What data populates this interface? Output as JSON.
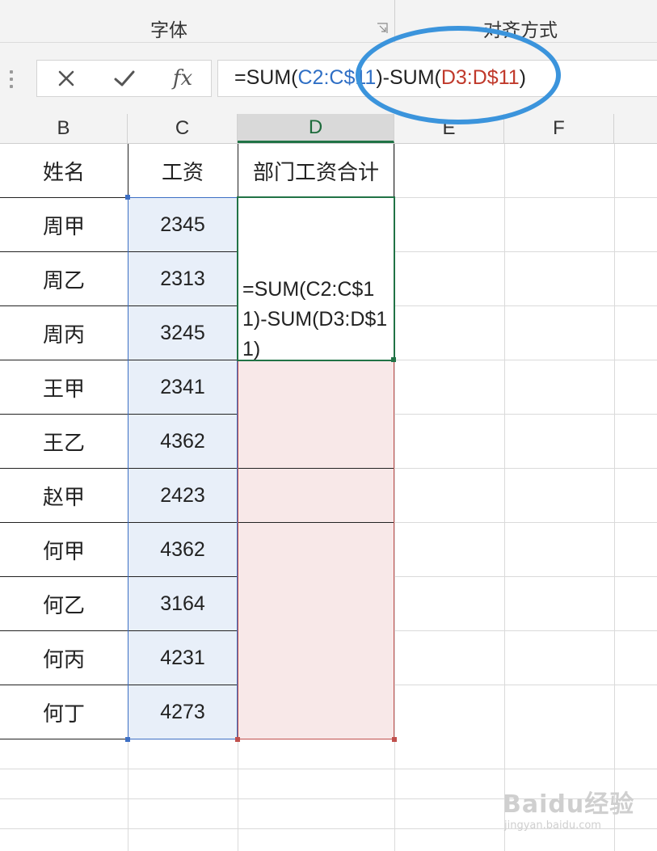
{
  "ribbon": {
    "groups": [
      {
        "label": "字体"
      },
      {
        "label": "对齐方式"
      }
    ]
  },
  "formula_bar": {
    "cancel_icon": "close-icon",
    "enter_icon": "check-icon",
    "fx_label": "fx",
    "formula_parts": {
      "prefix": "=SUM(",
      "ref1": "C2:C$11",
      "middle": ")-SUM(",
      "ref2": "D3:D$11",
      "suffix": ")"
    }
  },
  "columns": [
    "B",
    "C",
    "D",
    "E",
    "F"
  ],
  "selected_column": "D",
  "headers": {
    "name": "姓名",
    "salary": "工资",
    "dept_total": "部门工资合计"
  },
  "rows": [
    {
      "name": "周甲",
      "salary": "2345"
    },
    {
      "name": "周乙",
      "salary": "2313"
    },
    {
      "name": "周丙",
      "salary": "3245"
    },
    {
      "name": "王甲",
      "salary": "2341"
    },
    {
      "name": "王乙",
      "salary": "4362"
    },
    {
      "name": "赵甲",
      "salary": "2423"
    },
    {
      "name": "何甲",
      "salary": "4362"
    },
    {
      "name": "何乙",
      "salary": "3164"
    },
    {
      "name": "何丙",
      "salary": "4231"
    },
    {
      "name": "何丁",
      "salary": "4273"
    }
  ],
  "active_cell_text": "=SUM(C2:C$11)-SUM(D3:D$11)",
  "watermark": {
    "main": "Baidu经验",
    "sub": "jingyan.baidu.com"
  },
  "colors": {
    "ref_c": "#2f6fc5",
    "ref_d": "#c0392b",
    "annotation_circle": "#3b94dc",
    "active_border": "#217346"
  }
}
